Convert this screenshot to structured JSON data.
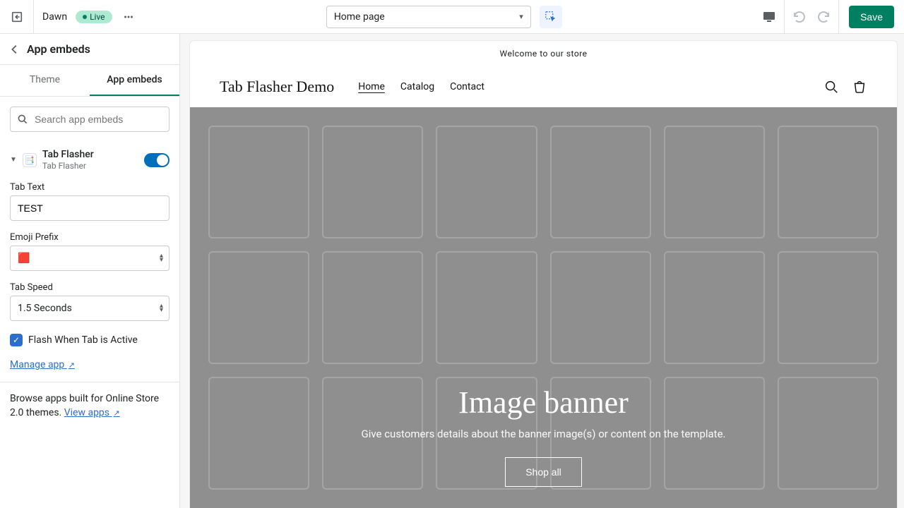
{
  "topbar": {
    "theme_name": "Dawn",
    "live_label": "Live",
    "page_selected": "Home page",
    "save_label": "Save"
  },
  "sidebar": {
    "title": "App embeds",
    "tabs": {
      "theme": "Theme",
      "app_embeds": "App embeds"
    },
    "search_placeholder": "Search app embeds",
    "embed": {
      "name": "Tab Flasher",
      "vendor": "Tab Flasher"
    },
    "settings": {
      "tab_text_label": "Tab Text",
      "tab_text_value": "TEST",
      "emoji_prefix_label": "Emoji Prefix",
      "emoji_prefix_value": "🟥",
      "tab_speed_label": "Tab Speed",
      "tab_speed_value": "1.5 Seconds",
      "flash_active_label": "Flash When Tab is Active",
      "manage_app_label": "Manage app"
    },
    "footer": {
      "text_before": "Browse apps built for Online Store 2.0 themes. ",
      "link": "View apps"
    }
  },
  "preview": {
    "announcement": "Welcome to our store",
    "site_title": "Tab Flasher Demo",
    "nav": {
      "home": "Home",
      "catalog": "Catalog",
      "contact": "Contact"
    },
    "hero": {
      "title": "Image banner",
      "subtitle": "Give customers details about the banner image(s) or content on the template.",
      "button": "Shop all"
    }
  }
}
